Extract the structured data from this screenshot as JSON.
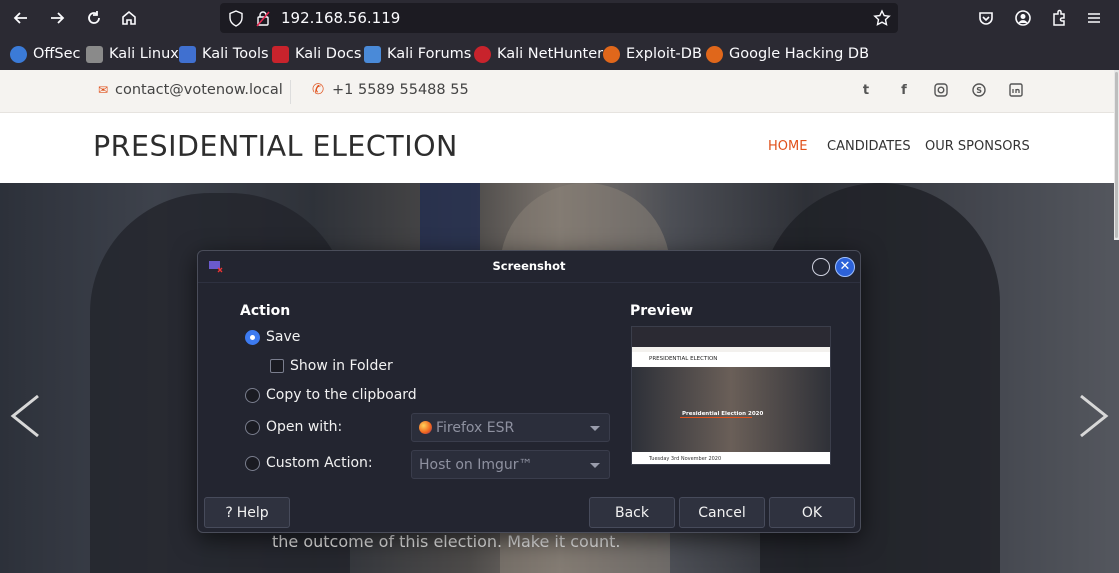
{
  "browser": {
    "url": "192.168.56.119",
    "bookmarks": [
      {
        "label": "OffSec",
        "color": "#3b7bd8"
      },
      {
        "label": "Kali Linux",
        "color": "#8a8a8a"
      },
      {
        "label": "Kali Tools",
        "color": "#4070d0"
      },
      {
        "label": "Kali Docs",
        "color": "#c8232c"
      },
      {
        "label": "Kali Forums",
        "color": "#4a8ad8"
      },
      {
        "label": "Kali NetHunter",
        "color": "#c8232c"
      },
      {
        "label": "Exploit-DB",
        "color": "#e0671b"
      },
      {
        "label": "Google Hacking DB",
        "color": "#e0671b"
      }
    ]
  },
  "site": {
    "email": "contact@votenow.local",
    "phone": "+1 5589 55488 55",
    "brand": "PRESIDENTIAL ELECTION",
    "nav": [
      "HOME",
      "CANDIDATES",
      "OUR SPONSORS"
    ],
    "hero_text": "the outcome of this election. Make it count.",
    "accent": "#e0511b"
  },
  "dialog": {
    "title": "Screenshot",
    "action_label": "Action",
    "preview_label": "Preview",
    "options": {
      "save": "Save",
      "show_in_folder": "Show in Folder",
      "copy": "Copy to the clipboard",
      "open_with": "Open with:",
      "custom_action": "Custom Action:"
    },
    "open_with_value": "Firefox ESR",
    "custom_action_value": "Host on Imgur™",
    "buttons": {
      "help": "Help",
      "back": "Back",
      "cancel": "Cancel",
      "ok": "OK"
    },
    "preview": {
      "brand": "PRESIDENTIAL ELECTION",
      "hero_title": "Presidential Election 2020",
      "footer": "Tuesday 3rd November 2020"
    }
  }
}
